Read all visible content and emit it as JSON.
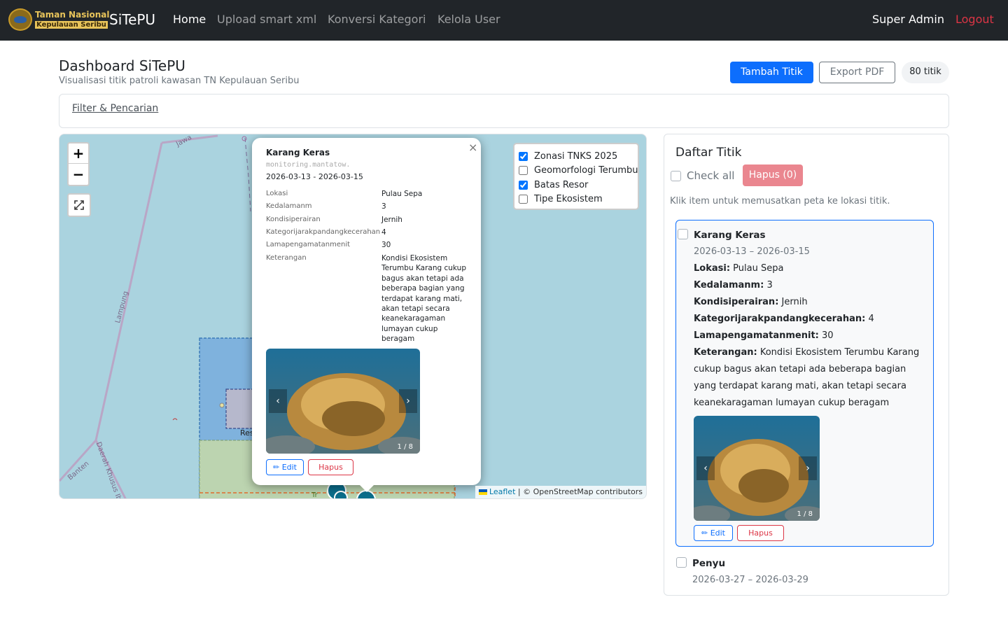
{
  "navbar": {
    "logo_line1": "Taman Nasional",
    "logo_line2": "Kepulauan Seribu",
    "brand": "SiTePU",
    "links": [
      "Home",
      "Upload smart xml",
      "Konversi Kategori",
      "Kelola User"
    ],
    "user": "Super Admin",
    "logout": "Logout"
  },
  "header": {
    "title": "Dashboard SiTePU",
    "subtitle": "Visualisasi titik patroli kawasan TN Kepulauan Seribu",
    "add_button": " Tambah Titik",
    "export_button": " Export PDF",
    "count_badge": "80 titik"
  },
  "filter": {
    "label": "Filter & Pencarian"
  },
  "map": {
    "zoom_in": "+",
    "zoom_out": "−",
    "labels": {
      "jawa": "Jawa",
      "lampung": "Lampung",
      "banten": "Banten",
      "dki": "Daerah Khusus Ibu",
      "resor": "Res",
      "tri": "Tr"
    },
    "layers": [
      {
        "label": "Zonasi TNKS 2025",
        "checked": true
      },
      {
        "label": "Geomorfologi Terumbu",
        "checked": false
      },
      {
        "label": "Batas Resor",
        "checked": true
      },
      {
        "label": "Tipe Ekosistem",
        "checked": false
      }
    ],
    "layer_glyph": "",
    "attribution_leaflet": "Leaflet",
    "attribution_rest": " | © OpenStreetMap contributors",
    "colors": {
      "sea": "#aad3df",
      "zone_blue": "#6fa8dc",
      "zone_green": "#b6d7a8",
      "marker": "#0b6e8c",
      "orange_border": "#e06b2c"
    }
  },
  "popup": {
    "close": "×",
    "title": "Karang Keras",
    "code": "monitoring.mantatow.",
    "date": "2026-03-13 - 2026-03-15",
    "fields": [
      {
        "key": "Lokasi",
        "value": "Pulau Sepa"
      },
      {
        "key": "Kedalamanm",
        "value": "3"
      },
      {
        "key": "Kondisiperairan",
        "value": "Jernih"
      },
      {
        "key": "Kategorijarakpandangkecerahan",
        "value": "4"
      },
      {
        "key": "Lamapengamatanmenit",
        "value": "30"
      },
      {
        "key": "Keterangan",
        "value": "Kondisi Ekosistem Terumbu Karang cukup bagus akan tetapi ada beberapa bagian yang terdapat karang mati, akan tetapi secara keanekaragaman lumayan cukup beragam"
      }
    ],
    "img_prev": "‹",
    "img_next": "›",
    "img_counter": "1 / 8",
    "edit": "✏ Edit",
    "delete": " Hapus"
  },
  "sidebar": {
    "title": "Daftar Titik",
    "check_all": "Check all",
    "delete_selected": "Hapus (0)",
    "hint": "Klik item untuk memusatkan peta ke lokasi titik.",
    "items": [
      {
        "title": "Karang Keras",
        "date": "2026-03-13 – 2026-03-15",
        "fields": [
          {
            "key": "Lokasi:",
            "value": "Pulau Sepa"
          },
          {
            "key": "Kedalamanm:",
            "value": "3"
          },
          {
            "key": "Kondisiperairan:",
            "value": "Jernih"
          },
          {
            "key": "Kategorijarakpandangkecerahan:",
            "value": "4"
          },
          {
            "key": "Lamapengamatanmenit:",
            "value": "30"
          }
        ],
        "desc_key": "Keterangan:",
        "desc_value": "Kondisi Ekosistem Terumbu Karang cukup bagus akan tetapi ada beberapa bagian yang terdapat karang mati, akan tetapi secara keanekaragaman lumayan cukup beragam",
        "img_prev": "‹",
        "img_next": "›",
        "img_counter": "1 / 8",
        "edit": "✏ Edit",
        "delete": " Hapus"
      },
      {
        "title": "Penyu",
        "date": "2026-03-27 – 2026-03-29"
      }
    ]
  }
}
